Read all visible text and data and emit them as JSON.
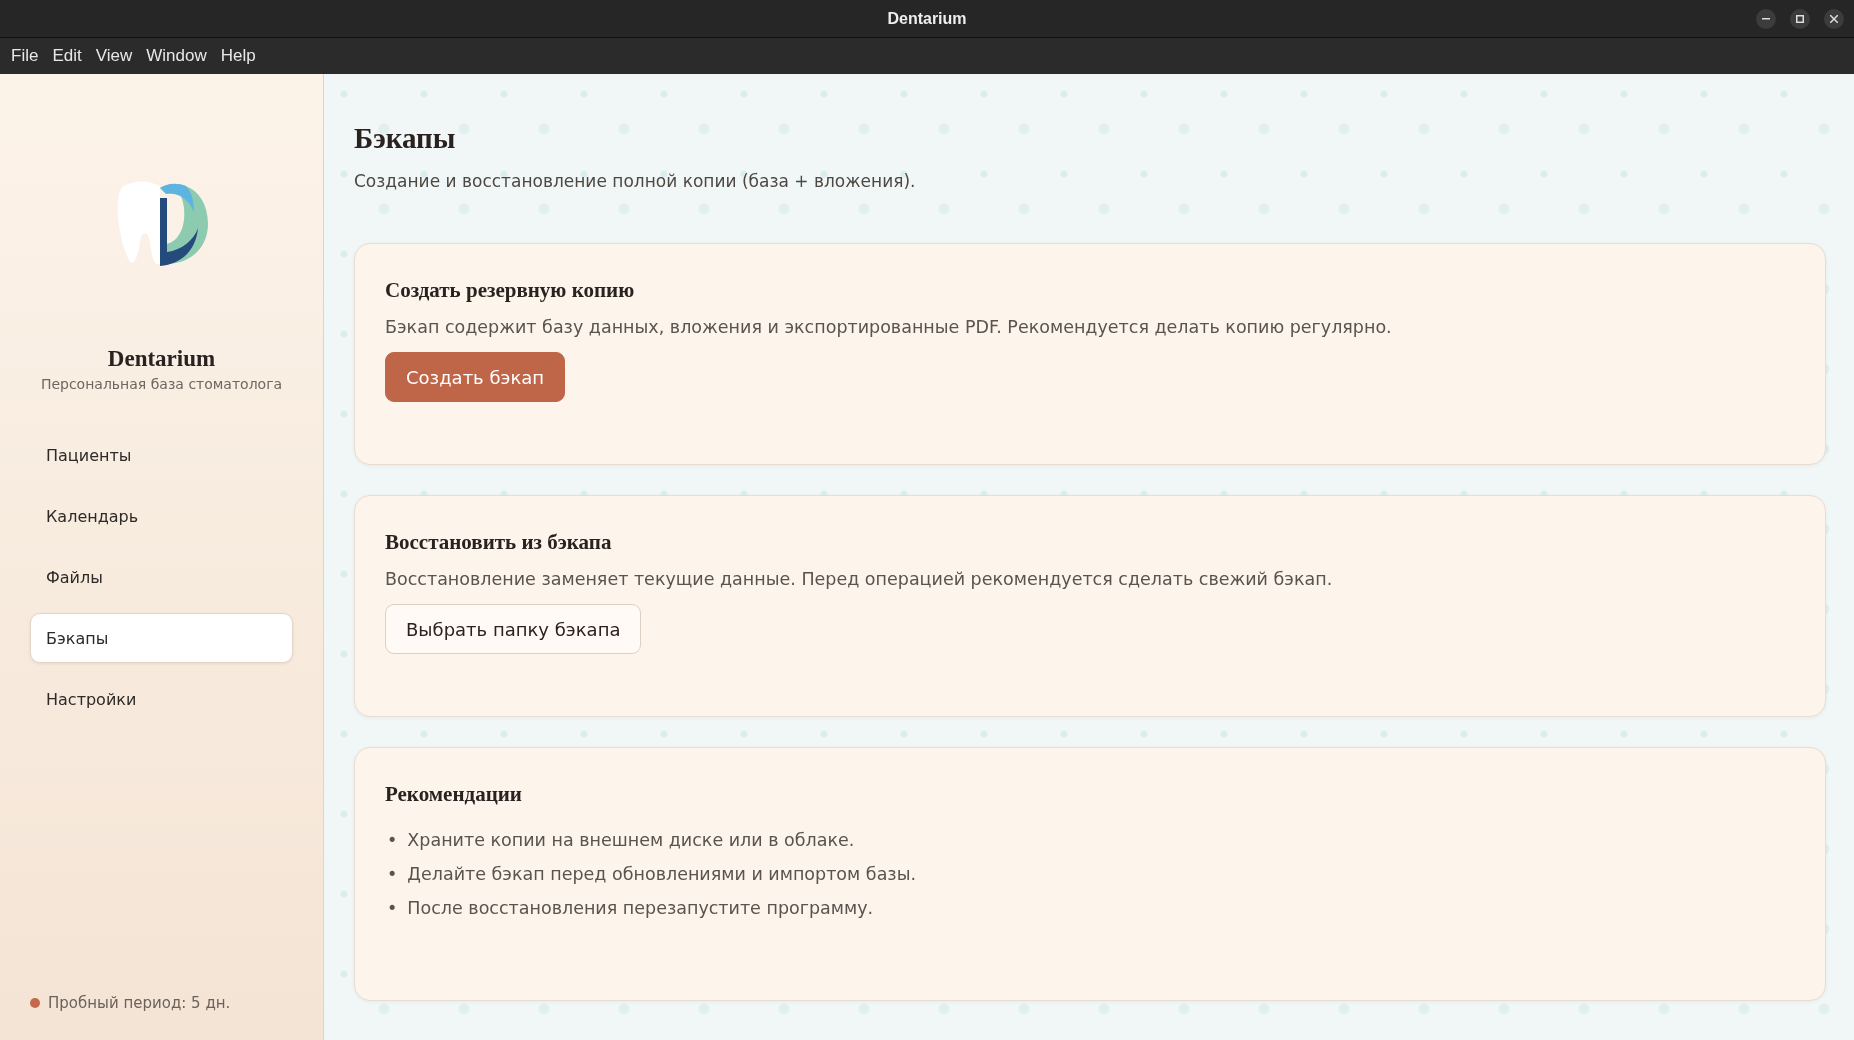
{
  "window": {
    "title": "Dentarium"
  },
  "menu": [
    "File",
    "Edit",
    "View",
    "Window",
    "Help"
  ],
  "sidebar": {
    "app_name": "Dentarium",
    "tagline": "Персональная база стоматолога",
    "items": [
      {
        "label": "Пациенты",
        "selected": false
      },
      {
        "label": "Календарь",
        "selected": false
      },
      {
        "label": "Файлы",
        "selected": false
      },
      {
        "label": "Бэкапы",
        "selected": true
      },
      {
        "label": "Настройки",
        "selected": false
      }
    ],
    "trial": "Пробный период: 5 дн."
  },
  "page": {
    "title": "Бэкапы",
    "subtitle": "Создание и восстановление полной копии (база + вложения).",
    "cards": [
      {
        "kind": "action",
        "title": "Создать резервную копию",
        "text": "Бэкап содержит базу данных, вложения и экспортированные PDF. Рекомендуется делать копию регулярно.",
        "button": {
          "label": "Создать бэкап",
          "primary": true
        }
      },
      {
        "kind": "action",
        "title": "Восстановить из бэкапа",
        "text": "Восстановление заменяет текущие данные. Перед операцией рекомендуется сделать свежий бэкап.",
        "button": {
          "label": "Выбрать папку бэкапа",
          "primary": false
        }
      },
      {
        "kind": "list",
        "title": "Рекомендации",
        "marker": "•",
        "items": [
          "Храните копии на внешнем диске или в облаке.",
          "Делайте бэкап перед обновлениями и импортом базы.",
          "После восстановления перезапустите программу."
        ]
      }
    ]
  }
}
